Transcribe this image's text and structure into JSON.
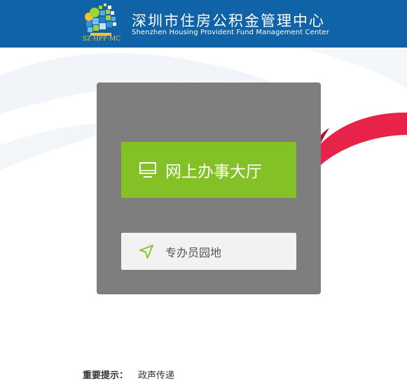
{
  "header": {
    "logo_text": "SZ·HPF·MC",
    "title_cn": "深圳市住房公积金管理中心",
    "title_en": "Shenzhen Housing Provident Fund Management Center"
  },
  "main": {
    "online_hall_label": "网上办事大厅",
    "agent_area_label": "专办员园地"
  },
  "notice": {
    "label": "重要提示：",
    "text": "政声传递"
  },
  "colors": {
    "header_bg": "#0f63a6",
    "primary_button": "#83c126",
    "panel_bg": "#7e7e7e",
    "secondary_button": "#f2f2f2",
    "ribbon": "#e8234a"
  },
  "icons": {
    "online_hall": "monitor-icon",
    "agent_area": "navigation-arrow-icon"
  }
}
